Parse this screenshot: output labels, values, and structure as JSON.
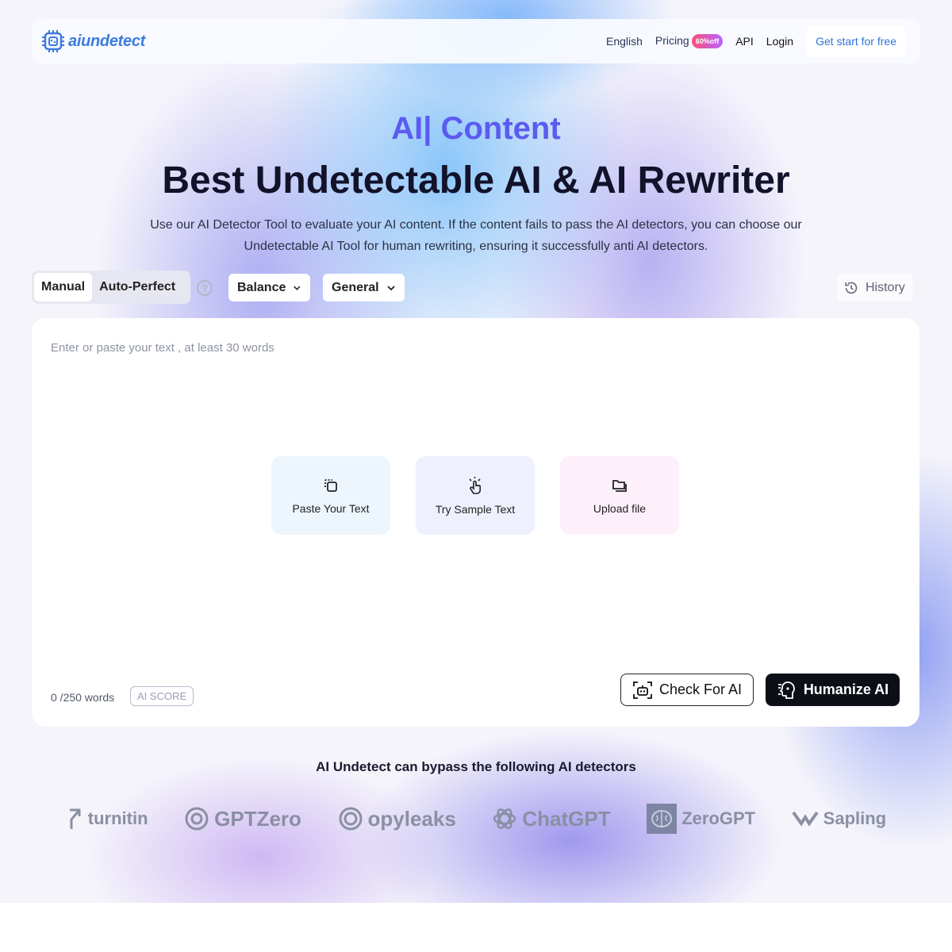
{
  "nav": {
    "brand": "aiundetect",
    "links": [
      "English",
      "Pricing",
      "API",
      "Login"
    ],
    "pricing_badge": "60%off",
    "cta": "Get start for free"
  },
  "hero": {
    "kicker": "AI| Content",
    "title": "Best Undetectable AI & AI Rewriter",
    "desc": "Use our AI Detector Tool to evaluate your AI content. If the content fails to pass the AI detectors, you can choose our Undetectable AI Tool for human rewriting, ensuring it successfully anti AI detectors."
  },
  "toolbar": {
    "modes": [
      "Manual",
      "Auto-Perfect"
    ],
    "help": "?",
    "strength": "Balance",
    "style": "General",
    "history": "History"
  },
  "editor": {
    "placeholder": "Enter or paste your text , at least 30 words",
    "cards": [
      "Paste Your Text",
      "Try Sample Text",
      "Upload file"
    ],
    "word_count": "0 /250 words",
    "ai_score": "AI SCORE",
    "check_button": "Check For AI",
    "humanize_button": "Humanize AI"
  },
  "bypass": {
    "title": "AI Undetect can bypass the following AI detectors",
    "detectors": [
      "turnitin",
      "GPTZero",
      "opyleaks",
      "ChatGPT",
      "ZeroGPT",
      "Sapling"
    ]
  },
  "colors": {
    "accent": "#5b5bf0",
    "brand_blue": "#3b7be0",
    "dark_button": "#0d0f17"
  }
}
